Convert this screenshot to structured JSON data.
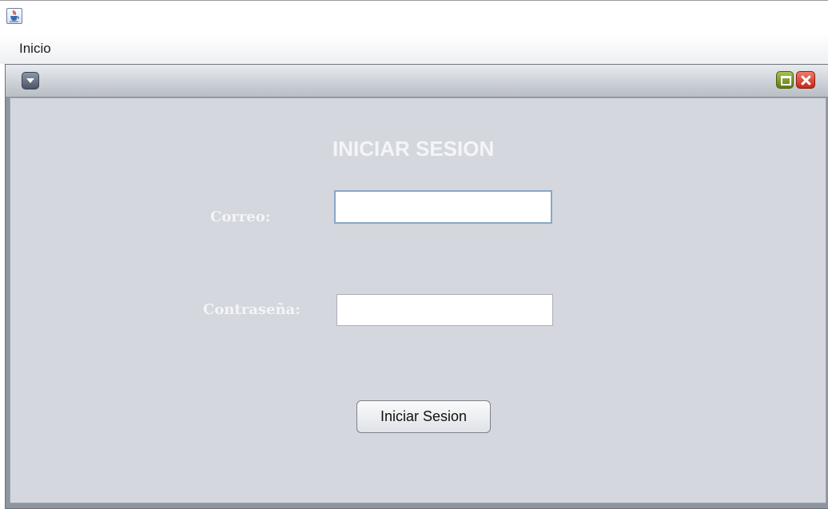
{
  "window": {
    "icon": "java-cup-icon"
  },
  "menubar": {
    "items": [
      {
        "label": "Inicio"
      }
    ]
  },
  "internal_frame": {
    "buttons": {
      "menu": "chevron-down-icon",
      "maximize": "maximize-icon",
      "close": "close-icon"
    }
  },
  "login": {
    "heading": "INICIAR SESION",
    "email_label": "Correo:",
    "email_value": "",
    "password_label": "Contraseña:",
    "password_value": "",
    "submit_label": "Iniciar Sesion"
  },
  "colors": {
    "content_bg": "#d4d7de",
    "text_light": "#f4f5f8",
    "close": "#d9432f",
    "maximize": "#7f9c26"
  }
}
